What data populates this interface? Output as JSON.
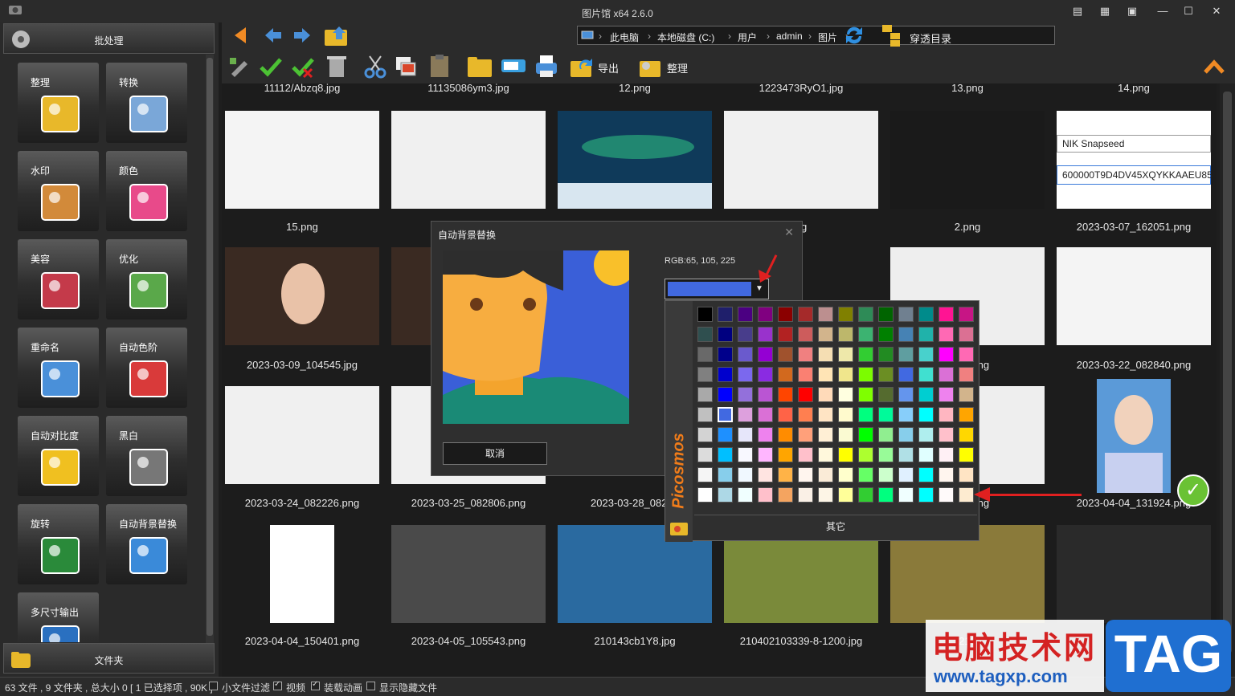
{
  "window": {
    "title": "图片馆 x64 2.6.0"
  },
  "sidebar": {
    "batch_label": "批处理",
    "folder_label": "文件夹",
    "tools": [
      {
        "label": "整理"
      },
      {
        "label": "转换"
      },
      {
        "label": "水印"
      },
      {
        "label": "颜色"
      },
      {
        "label": "美容"
      },
      {
        "label": "优化"
      },
      {
        "label": "重命名"
      },
      {
        "label": "自动色阶"
      },
      {
        "label": "自动对比度"
      },
      {
        "label": "黑白"
      },
      {
        "label": "旋转"
      },
      {
        "label": "自动背景替换"
      },
      {
        "label": "多尺寸输出"
      }
    ]
  },
  "addressbar": {
    "crumbs": [
      "此电脑",
      "本地磁盘 (C:)",
      "用户",
      "admin",
      "图片"
    ],
    "through_label": "穿透目录"
  },
  "toolbar": {
    "export_label": "导出",
    "organize_label": "整理"
  },
  "files": {
    "row0": [
      "11112/Abzq8.jpg",
      "11135086ym3.jpg",
      "12.png",
      "1223473RyO1.jpg",
      "13.png",
      "14.png"
    ],
    "row1": [
      "15.png",
      "",
      "",
      "ng",
      "2.png",
      "2023-03-07_162051.png"
    ],
    "row2": [
      "2023-03-09_104545.jpg",
      "202",
      "",
      "",
      "2821.png",
      "2023-03-22_082840.png"
    ],
    "row3": [
      "2023-03-24_082226.png",
      "2023-03-25_082806.png",
      "2023-03-28_08270",
      "",
      "1923.png",
      "2023-04-04_131924.png"
    ],
    "row4": [
      "2023-04-04_150401.png",
      "2023-04-05_105543.png",
      "210143cb1Y8.jpg",
      "210402103339-8-1200.jpg",
      "210",
      ""
    ],
    "snapseed_name": "NIK Snapseed",
    "snapseed_code": "600000T9D4DV45XQYKKAAEU85"
  },
  "dialog": {
    "title": "自动背景替换",
    "rgb": "RGB:65, 105, 225",
    "selected_color": "#4169e1",
    "cancel_label": "取消"
  },
  "picker": {
    "brand": "Picosmos",
    "other_label": "其它"
  },
  "status": {
    "summary": "63 文件 , 9 文件夹 , 总大小 0 [ 1 已选择项 , 90K ]",
    "small_filter": "小文件过滤",
    "video": "视频",
    "anim": "装载动画",
    "hidden": "显示隐藏文件"
  },
  "watermark": {
    "site_cn": "电脑技术网",
    "site_url": "www.tagxp.com",
    "tag": "TAG"
  }
}
